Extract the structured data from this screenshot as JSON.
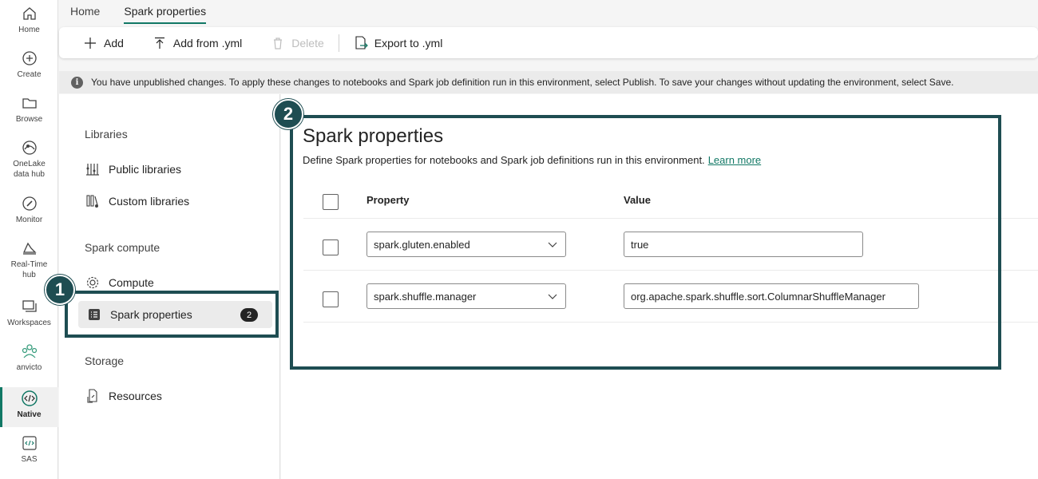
{
  "rail": {
    "items": [
      {
        "label": "Home",
        "icon": "home-icon"
      },
      {
        "label": "Create",
        "icon": "plus-circle-icon"
      },
      {
        "label": "Browse",
        "icon": "folder-icon"
      },
      {
        "label_line1": "OneLake",
        "label_line2": "data hub",
        "icon": "onelake-icon"
      },
      {
        "label": "Monitor",
        "icon": "monitor-icon"
      },
      {
        "label_line1": "Real-Time",
        "label_line2": "hub",
        "icon": "realtime-hub-icon"
      },
      {
        "label": "Workspaces",
        "icon": "workspaces-icon"
      },
      {
        "label": "anvicto",
        "icon": "workspace-people-icon"
      },
      {
        "label": "Native",
        "icon": "environment-icon"
      },
      {
        "label": "SAS",
        "icon": "sas-environment-icon"
      }
    ]
  },
  "tabs": [
    {
      "label": "Home"
    },
    {
      "label": "Spark properties"
    }
  ],
  "toolbar": {
    "add": "Add",
    "add_from_yml": "Add from .yml",
    "delete": "Delete",
    "export_to_yml": "Export to .yml"
  },
  "info": {
    "message": "You have unpublished changes. To apply these changes to notebooks and Spark job definition run in this environment, select Publish. To save your changes without updating the environment, select Save."
  },
  "nav": {
    "libraries_heading": "Libraries",
    "public_libraries": "Public libraries",
    "custom_libraries": "Custom libraries",
    "spark_compute_heading": "Spark compute",
    "compute": "Compute",
    "spark_properties": "Spark properties",
    "spark_properties_count": "2",
    "storage_heading": "Storage",
    "resources": "Resources"
  },
  "callouts": {
    "one": "1",
    "two": "2"
  },
  "content": {
    "title": "Spark properties",
    "description": "Define Spark properties for notebooks and Spark job definitions run in this environment.",
    "learn_more": "Learn more",
    "col_property": "Property",
    "col_value": "Value",
    "rows": [
      {
        "property": "spark.gluten.enabled",
        "value": "true"
      },
      {
        "property": "spark.shuffle.manager",
        "value": "org.apache.spark.shuffle.sort.ColumnarShuffleManager"
      }
    ]
  },
  "colors": {
    "accent": "#117865",
    "callout": "#1e4d52"
  }
}
